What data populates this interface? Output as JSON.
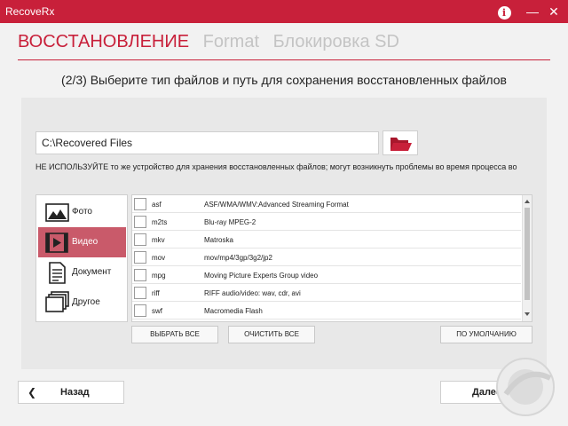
{
  "window": {
    "title": "RecoveRx",
    "info_icon": "info-icon",
    "minimize_glyph": "—",
    "close_glyph": "✕"
  },
  "modes": {
    "active": "ВОССТАНОВЛЕНИЕ",
    "format": "Format",
    "lock": "Блокировка SD"
  },
  "step_title": "(2/3) Выберите тип файлов и путь для сохранения восстановленных файлов",
  "path": {
    "value": "C:\\Recovered Files",
    "browse_icon": "folder-open-icon"
  },
  "warning": "НЕ ИСПОЛЬЗУЙТЕ то же устройство для хранения восстановленных файлов; могут возникнуть проблемы во время процесса во",
  "categories": [
    {
      "label": "Фото",
      "icon": "photo-icon",
      "selected": false
    },
    {
      "label": "Видео",
      "icon": "video-icon",
      "selected": true
    },
    {
      "label": "Документ",
      "icon": "document-icon",
      "selected": false
    },
    {
      "label": "Другое",
      "icon": "other-icon",
      "selected": false
    }
  ],
  "file_types": [
    {
      "ext": "asf",
      "desc": "ASF/WMA/WMV:Advanced Streaming Format",
      "checked": false
    },
    {
      "ext": "m2ts",
      "desc": "Blu-ray MPEG-2",
      "checked": false
    },
    {
      "ext": "mkv",
      "desc": "Matroska",
      "checked": false
    },
    {
      "ext": "mov",
      "desc": "mov/mp4/3gp/3g2/jp2",
      "checked": false
    },
    {
      "ext": "mpg",
      "desc": "Moving Picture Experts Group video",
      "checked": false
    },
    {
      "ext": "riff",
      "desc": "RIFF audio/video: wav, cdr, avi",
      "checked": false
    },
    {
      "ext": "swf",
      "desc": "Macromedia Flash",
      "checked": false
    }
  ],
  "buttons": {
    "select_all": "ВЫБРАТЬ ВСЕ",
    "clear_all": "ОЧИСТИТЬ ВСЕ",
    "default": "ПО УМОЛЧАНИЮ"
  },
  "nav": {
    "back": "Назад",
    "next": "Далее",
    "back_icon": "chevron-left-icon",
    "next_icon": "chevron-right-icon"
  },
  "colors": {
    "accent": "#c8203a",
    "selected_category": "#c95a6a",
    "panel": "#e8e8e8",
    "inactive_tab": "#c4c4c4"
  }
}
